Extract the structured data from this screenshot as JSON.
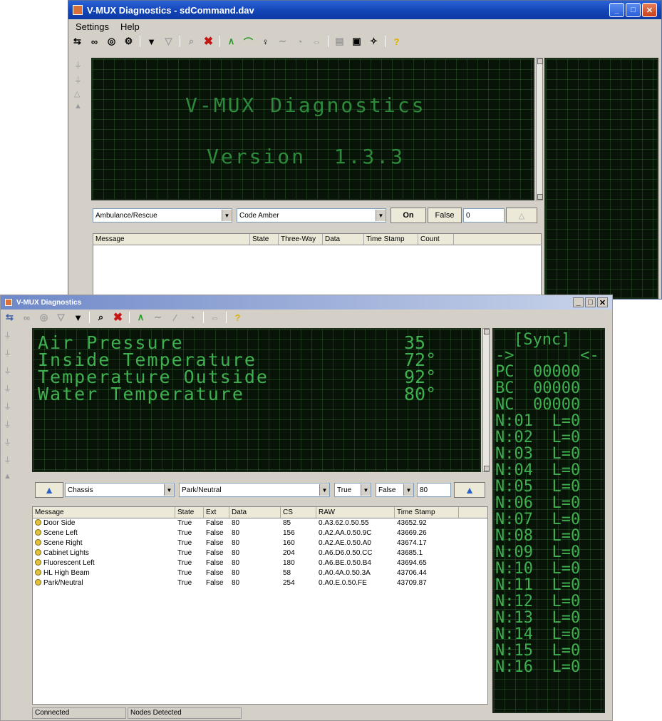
{
  "back_window": {
    "title": "V-MUX Diagnostics - sdCommand.dav",
    "menu": [
      "Settings",
      "Help"
    ],
    "lcd_lines": [
      "V-MUX Diagnostics",
      "Version  1.3.3"
    ],
    "controls": {
      "combo1": "Ambulance/Rescue",
      "combo2": "Code Amber",
      "on_button": "On",
      "false_button": "False",
      "value_field": "0"
    },
    "columns": [
      "Message",
      "State",
      "Three-Way",
      "Data",
      "Time Stamp",
      "Count"
    ]
  },
  "front_window": {
    "title": "V-MUX Diagnostics",
    "lcd_rows": [
      {
        "label": "Air Pressure",
        "value": "35"
      },
      {
        "label": "Inside Temperature",
        "value": "72°"
      },
      {
        "label": "Temperature Outside",
        "value": "92°"
      },
      {
        "label": "Water Temperature",
        "value": "80°"
      }
    ],
    "side_lcd": {
      "sync": "[Sync]",
      "arrows": "->       <-",
      "pc": "PC  00000",
      "bc": "BC  00000",
      "nc": "NC  00000",
      "nodes": [
        "N:01  L=0",
        "N:02  L=0",
        "N:03  L=0",
        "N:04  L=0",
        "N:05  L=0",
        "N:06  L=0",
        "N:07  L=0",
        "N:08  L=0",
        "N:09  L=0",
        "N:10  L=0",
        "N:11  L=0",
        "N:12  L=0",
        "N:13  L=0",
        "N:14  L=0",
        "N:15  L=0",
        "N:16  L=0"
      ]
    },
    "controls": {
      "combo1": "Chassis",
      "combo2": "Park/Neutral",
      "combo3": "True",
      "combo4": "False",
      "value_field": "80"
    },
    "columns": [
      "Message",
      "State",
      "Ext",
      "Data",
      "CS",
      "RAW",
      "Time Stamp"
    ],
    "rows": [
      [
        "Door Side",
        "True",
        "False",
        "80",
        "85",
        "0.A3.62.0.50.55",
        "43652.92"
      ],
      [
        "Scene Left",
        "True",
        "False",
        "80",
        "156",
        "0.A2.AA.0.50.9C",
        "43669.26"
      ],
      [
        "Scene Right",
        "True",
        "False",
        "80",
        "160",
        "0.A2.AE.0.50.A0",
        "43674.17"
      ],
      [
        "Cabinet Lights",
        "True",
        "False",
        "80",
        "204",
        "0.A6.D6.0.50.CC",
        "43685.1"
      ],
      [
        "Fluorescent Left",
        "True",
        "False",
        "80",
        "180",
        "0.A6.BE.0.50.B4",
        "43694.65"
      ],
      [
        "HL High Beam",
        "True",
        "False",
        "80",
        "58",
        "0.A0.4A.0.50.3A",
        "43706.44"
      ],
      [
        "Park/Neutral",
        "True",
        "False",
        "80",
        "254",
        "0.A0.E.0.50.FE",
        "43709.87"
      ]
    ],
    "status": [
      "Connected",
      "Nodes Detected"
    ]
  }
}
